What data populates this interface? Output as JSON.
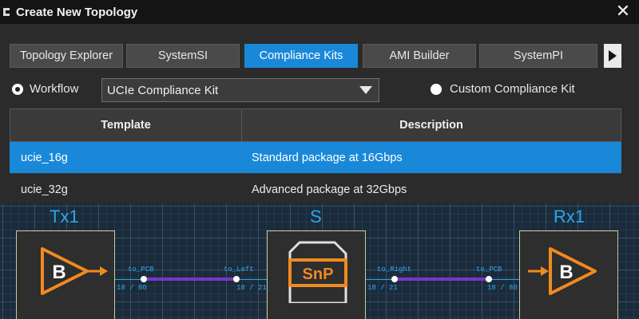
{
  "window": {
    "title": "Create New Topology",
    "close_glyph": "✕"
  },
  "tabs": [
    {
      "label": "Topology Explorer",
      "active": false
    },
    {
      "label": "SystemSI",
      "active": false
    },
    {
      "label": "Compliance Kits",
      "active": true
    },
    {
      "label": "AMI Builder",
      "active": false
    },
    {
      "label": "SystemPI",
      "active": false
    }
  ],
  "workflow": {
    "radio_label": "Workflow",
    "selected": true,
    "select_value": "UCIe Compliance Kit",
    "custom_label": "Custom Compliance Kit",
    "custom_selected": false
  },
  "table": {
    "headers": [
      "Template",
      "Description"
    ],
    "rows": [
      {
        "template": "ucie_16g",
        "description": "Standard package at 16Gbps",
        "selected": true
      },
      {
        "template": "ucie_32g",
        "description": "Advanced package at 32Gbps",
        "selected": false
      }
    ]
  },
  "schematic": {
    "components": [
      {
        "label": "Tx1",
        "symbol": "B"
      },
      {
        "label": "S",
        "symbol": "SnP"
      },
      {
        "label": "Rx1",
        "symbol": "B"
      }
    ],
    "ports": [
      {
        "name": "to_PCB",
        "pins": "18 / 80"
      },
      {
        "name": "to_Left",
        "pins": "18 / 21"
      },
      {
        "name": "to_Right",
        "pins": "18 / 21"
      },
      {
        "name": "to_PCB",
        "pins": "18 / 80"
      }
    ]
  },
  "colors": {
    "accent": "#1a88d8",
    "orange": "#f08a20",
    "wire": "#7a36c8",
    "label_blue": "#2aa8e8"
  }
}
